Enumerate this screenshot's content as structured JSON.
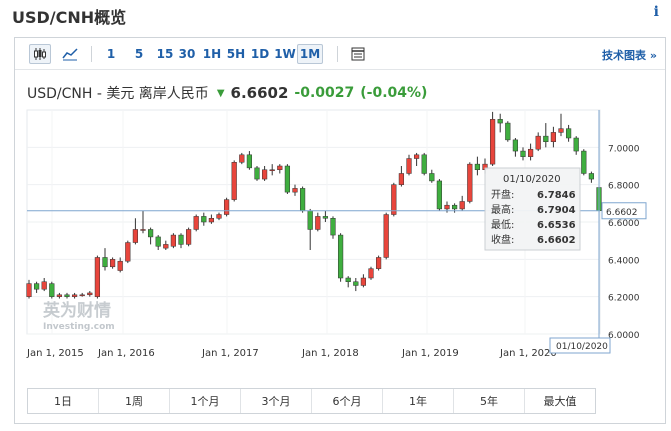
{
  "page": {
    "title": "USD/CNH概览",
    "info_icon": "info-icon"
  },
  "toolbar": {
    "icons": [
      "candlestick-chart-icon",
      "line-chart-icon",
      "table-view-icon"
    ],
    "intervals": [
      "1",
      "5",
      "15",
      "30",
      "1H",
      "5H",
      "1D",
      "1W",
      "1M"
    ],
    "active_interval": "1M",
    "tech_chart_label": "技术图表",
    "tech_chart_arrow": "»"
  },
  "quote": {
    "pair": "USD/CNH - 美元 离岸人民币",
    "price": "6.6602",
    "change": "-0.0027",
    "change_pct": "(-0.04%)",
    "direction": "down",
    "change_color": "#3a9c3a"
  },
  "tooltip": {
    "date": "01/10/2020",
    "rows": [
      {
        "label": "开盘:",
        "value": "6.7846"
      },
      {
        "label": "最高:",
        "value": "6.7904"
      },
      {
        "label": "最低:",
        "value": "6.6536"
      },
      {
        "label": "收盘:",
        "value": "6.6602"
      }
    ]
  },
  "watermark": {
    "line1": "英为财情",
    "line2": "Investing.com"
  },
  "range_buttons": [
    "1日",
    "1周",
    "1个月",
    "3个月",
    "6个月",
    "1年",
    "5年",
    "最大值"
  ],
  "chart_data": {
    "type": "candlestick",
    "x_tick_labels": [
      "Jan 1, 2015",
      "Jan 1, 2016",
      "Jan 1, 2017",
      "Jan 1, 2018",
      "Jan 1, 2019",
      "Jan 1, 2020"
    ],
    "y_tick_labels": [
      "6.0000",
      "6.2000",
      "6.4000",
      "6.6000",
      "6.8000",
      "7.0000"
    ],
    "ylim": [
      6.0,
      7.2
    ],
    "current_price_label": "6.6602",
    "crosshair_date_label": "01/10/2020",
    "up_color": "#e8453c",
    "down_color": "#3fae3f",
    "candles": [
      {
        "o": 6.2,
        "c": 6.27,
        "h": 6.29,
        "l": 6.19
      },
      {
        "o": 6.27,
        "c": 6.24,
        "h": 6.28,
        "l": 6.22
      },
      {
        "o": 6.24,
        "c": 6.28,
        "h": 6.3,
        "l": 6.23
      },
      {
        "o": 6.27,
        "c": 6.2,
        "h": 6.28,
        "l": 6.19
      },
      {
        "o": 6.2,
        "c": 6.21,
        "h": 6.22,
        "l": 6.19
      },
      {
        "o": 6.21,
        "c": 6.2,
        "h": 6.22,
        "l": 6.19
      },
      {
        "o": 6.2,
        "c": 6.21,
        "h": 6.22,
        "l": 6.19
      },
      {
        "o": 6.21,
        "c": 6.21,
        "h": 6.22,
        "l": 6.2
      },
      {
        "o": 6.21,
        "c": 6.22,
        "h": 6.23,
        "l": 6.2
      },
      {
        "o": 6.2,
        "c": 6.41,
        "h": 6.42,
        "l": 6.19
      },
      {
        "o": 6.41,
        "c": 6.36,
        "h": 6.46,
        "l": 6.34
      },
      {
        "o": 6.36,
        "c": 6.4,
        "h": 6.41,
        "l": 6.35
      },
      {
        "o": 6.34,
        "c": 6.39,
        "h": 6.41,
        "l": 6.33
      },
      {
        "o": 6.39,
        "c": 6.49,
        "h": 6.5,
        "l": 6.38
      },
      {
        "o": 6.49,
        "c": 6.56,
        "h": 6.62,
        "l": 6.48
      },
      {
        "o": 6.56,
        "c": 6.56,
        "h": 6.66,
        "l": 6.54
      },
      {
        "o": 6.56,
        "c": 6.52,
        "h": 6.57,
        "l": 6.48
      },
      {
        "o": 6.52,
        "c": 6.47,
        "h": 6.53,
        "l": 6.45
      },
      {
        "o": 6.46,
        "c": 6.48,
        "h": 6.5,
        "l": 6.45
      },
      {
        "o": 6.47,
        "c": 6.53,
        "h": 6.54,
        "l": 6.46
      },
      {
        "o": 6.53,
        "c": 6.48,
        "h": 6.54,
        "l": 6.46
      },
      {
        "o": 6.48,
        "c": 6.56,
        "h": 6.57,
        "l": 6.47
      },
      {
        "o": 6.56,
        "c": 6.63,
        "h": 6.64,
        "l": 6.55
      },
      {
        "o": 6.63,
        "c": 6.6,
        "h": 6.65,
        "l": 6.58
      },
      {
        "o": 6.6,
        "c": 6.62,
        "h": 6.64,
        "l": 6.59
      },
      {
        "o": 6.62,
        "c": 6.64,
        "h": 6.65,
        "l": 6.61
      },
      {
        "o": 6.64,
        "c": 6.72,
        "h": 6.73,
        "l": 6.63
      },
      {
        "o": 6.72,
        "c": 6.92,
        "h": 6.93,
        "l": 6.71
      },
      {
        "o": 6.92,
        "c": 6.96,
        "h": 6.97,
        "l": 6.91
      },
      {
        "o": 6.96,
        "c": 6.89,
        "h": 6.98,
        "l": 6.88
      },
      {
        "o": 6.89,
        "c": 6.83,
        "h": 6.9,
        "l": 6.82
      },
      {
        "o": 6.83,
        "c": 6.88,
        "h": 6.9,
        "l": 6.82
      },
      {
        "o": 6.88,
        "c": 6.88,
        "h": 6.91,
        "l": 6.85
      },
      {
        "o": 6.88,
        "c": 6.9,
        "h": 6.91,
        "l": 6.86
      },
      {
        "o": 6.9,
        "c": 6.76,
        "h": 6.91,
        "l": 6.75
      },
      {
        "o": 6.76,
        "c": 6.78,
        "h": 6.8,
        "l": 6.74
      },
      {
        "o": 6.78,
        "c": 6.66,
        "h": 6.79,
        "l": 6.65
      },
      {
        "o": 6.66,
        "c": 6.56,
        "h": 6.67,
        "l": 6.45
      },
      {
        "o": 6.56,
        "c": 6.63,
        "h": 6.65,
        "l": 6.55
      },
      {
        "o": 6.63,
        "c": 6.62,
        "h": 6.66,
        "l": 6.6
      },
      {
        "o": 6.62,
        "c": 6.53,
        "h": 6.63,
        "l": 6.51
      },
      {
        "o": 6.53,
        "c": 6.3,
        "h": 6.54,
        "l": 6.28
      },
      {
        "o": 6.3,
        "c": 6.28,
        "h": 6.31,
        "l": 6.25
      },
      {
        "o": 6.28,
        "c": 6.26,
        "h": 6.3,
        "l": 6.23
      },
      {
        "o": 6.26,
        "c": 6.3,
        "h": 6.32,
        "l": 6.25
      },
      {
        "o": 6.3,
        "c": 6.35,
        "h": 6.36,
        "l": 6.29
      },
      {
        "o": 6.35,
        "c": 6.41,
        "h": 6.42,
        "l": 6.34
      },
      {
        "o": 6.41,
        "c": 6.64,
        "h": 6.65,
        "l": 6.4
      },
      {
        "o": 6.64,
        "c": 6.8,
        "h": 6.81,
        "l": 6.63
      },
      {
        "o": 6.8,
        "c": 6.86,
        "h": 6.9,
        "l": 6.79
      },
      {
        "o": 6.86,
        "c": 6.94,
        "h": 6.96,
        "l": 6.85
      },
      {
        "o": 6.94,
        "c": 6.96,
        "h": 6.97,
        "l": 6.9
      },
      {
        "o": 6.96,
        "c": 6.86,
        "h": 6.97,
        "l": 6.85
      },
      {
        "o": 6.86,
        "c": 6.82,
        "h": 6.88,
        "l": 6.81
      },
      {
        "o": 6.82,
        "c": 6.67,
        "h": 6.83,
        "l": 6.66
      },
      {
        "o": 6.67,
        "c": 6.69,
        "h": 6.71,
        "l": 6.65
      },
      {
        "o": 6.69,
        "c": 6.67,
        "h": 6.7,
        "l": 6.65
      },
      {
        "o": 6.67,
        "c": 6.71,
        "h": 6.74,
        "l": 6.66
      },
      {
        "o": 6.71,
        "c": 6.91,
        "h": 6.92,
        "l": 6.7
      },
      {
        "o": 6.91,
        "c": 6.88,
        "h": 6.95,
        "l": 6.85
      },
      {
        "o": 6.88,
        "c": 6.91,
        "h": 6.94,
        "l": 6.86
      },
      {
        "o": 6.91,
        "c": 7.15,
        "h": 7.19,
        "l": 6.9
      },
      {
        "o": 7.15,
        "c": 7.13,
        "h": 7.18,
        "l": 7.08
      },
      {
        "o": 7.13,
        "c": 7.04,
        "h": 7.14,
        "l": 7.03
      },
      {
        "o": 7.04,
        "c": 6.98,
        "h": 7.05,
        "l": 6.95
      },
      {
        "o": 6.98,
        "c": 6.95,
        "h": 7.0,
        "l": 6.93
      },
      {
        "o": 6.95,
        "c": 6.99,
        "h": 7.02,
        "l": 6.93
      },
      {
        "o": 6.99,
        "c": 7.06,
        "h": 7.08,
        "l": 6.98
      },
      {
        "o": 7.06,
        "c": 7.03,
        "h": 7.13,
        "l": 7.0
      },
      {
        "o": 7.03,
        "c": 7.08,
        "h": 7.11,
        "l": 7.0
      },
      {
        "o": 7.08,
        "c": 7.1,
        "h": 7.18,
        "l": 7.06
      },
      {
        "o": 7.1,
        "c": 7.05,
        "h": 7.12,
        "l": 7.03
      },
      {
        "o": 7.05,
        "c": 6.98,
        "h": 7.06,
        "l": 6.96
      },
      {
        "o": 6.98,
        "c": 6.86,
        "h": 6.99,
        "l": 6.85
      },
      {
        "o": 6.86,
        "c": 6.83,
        "h": 6.87,
        "l": 6.81
      },
      {
        "o": 6.7846,
        "c": 6.6602,
        "h": 6.7904,
        "l": 6.6536
      }
    ]
  }
}
